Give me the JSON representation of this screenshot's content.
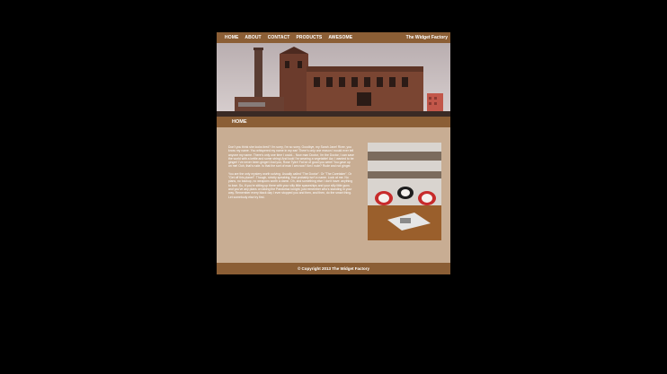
{
  "nav": {
    "items": [
      "HOME",
      "ABOUT",
      "CONTACT",
      "PRODUCTS",
      "AWESOME"
    ],
    "brand": "The Widget Factory"
  },
  "hero": {
    "alt": "abandoned brick factory building"
  },
  "section": {
    "title": "HOME"
  },
  "content": {
    "paragraphs": [
      "Don't you think she looks tired? I'm sorry, I'm so sorry. Goodbye, my Sarah Jane! River, you know my name. You whispered my name in my ear! There's only one reason I would ever tell anyone my name. There's only one time I could... Now man Doctor, I'm the Doctor, I can save the world with a kettle and some string! And look! I'm wearing a vegetable! Aw, I wanted to be ginger! I've never been ginger! And you, Rose Tyler! Fat lot of good you were! You gave up on me! Ooh, that's rude. Is that the sort of man I am now? Am I rude? Rude and not ginger.",
      "You are the only mystery worth solving. Usually called \"The Doctor\". Or \"The Caretaker\". Or \"Get off this planet\". Though, strictly speaking, that probably isn't a name. Look at me. No plans, no backup, no weapons worth a damn. Oh, and something else I don't have: anything to lose. So, if you're sitting up there with your silly little spaceships and your silly little guns and you've any plans on taking the Pandorica tonight; just remember who's standing in your way. Remember every black day I ever stopped you and then, and then, do the smart thing. Let somebody else try first."
    ]
  },
  "photo": {
    "alt": "modern interior with red chairs and coffee table"
  },
  "footer": {
    "copyright": "© Copyright 2013 The Widget Factory"
  },
  "colors": {
    "bar": "#8b5e35",
    "content_bg": "#c8ad93",
    "page_bg": "#000000"
  }
}
